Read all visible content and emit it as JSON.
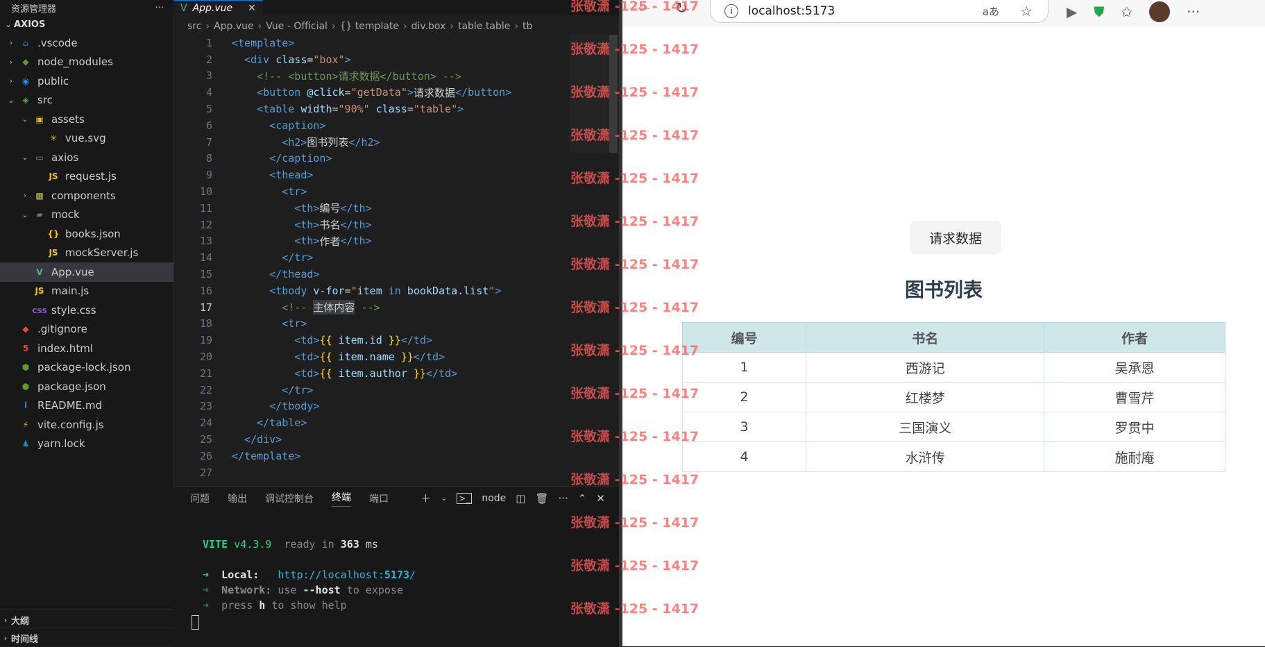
{
  "explorer": {
    "header": "资源管理器",
    "root": "AXIOS",
    "items": [
      {
        "name": ".vscode",
        "depth": 0,
        "chevron": "›",
        "icon": "vscode-folder"
      },
      {
        "name": "node_modules",
        "depth": 0,
        "chevron": "›",
        "icon": "node-folder"
      },
      {
        "name": "public",
        "depth": 0,
        "chevron": "›",
        "icon": "public-folder"
      },
      {
        "name": "src",
        "depth": 0,
        "chevron": "⌄",
        "icon": "src-folder"
      },
      {
        "name": "assets",
        "depth": 1,
        "chevron": "⌄",
        "icon": "assets-folder"
      },
      {
        "name": "vue.svg",
        "depth": 2,
        "chevron": "",
        "icon": "svg-file"
      },
      {
        "name": "axios",
        "depth": 1,
        "chevron": "⌄",
        "icon": "folder"
      },
      {
        "name": "request.js",
        "depth": 2,
        "chevron": "",
        "icon": "js-file"
      },
      {
        "name": "components",
        "depth": 1,
        "chevron": "›",
        "icon": "components-folder"
      },
      {
        "name": "mock",
        "depth": 1,
        "chevron": "⌄",
        "icon": "mock-folder"
      },
      {
        "name": "books.json",
        "depth": 2,
        "chevron": "",
        "icon": "json-file"
      },
      {
        "name": "mockServer.js",
        "depth": 2,
        "chevron": "",
        "icon": "js-file"
      },
      {
        "name": "App.vue",
        "depth": 1,
        "chevron": "",
        "icon": "vue-file",
        "selected": true
      },
      {
        "name": "main.js",
        "depth": 1,
        "chevron": "",
        "icon": "js-file"
      },
      {
        "name": "style.css",
        "depth": 1,
        "chevron": "",
        "icon": "css-file"
      },
      {
        "name": ".gitignore",
        "depth": 0,
        "chevron": "",
        "icon": "git-file"
      },
      {
        "name": "index.html",
        "depth": 0,
        "chevron": "",
        "icon": "html-file"
      },
      {
        "name": "package-lock.json",
        "depth": 0,
        "chevron": "",
        "icon": "node-file"
      },
      {
        "name": "package.json",
        "depth": 0,
        "chevron": "",
        "icon": "node-file"
      },
      {
        "name": "README.md",
        "depth": 0,
        "chevron": "",
        "icon": "info-file"
      },
      {
        "name": "vite.config.js",
        "depth": 0,
        "chevron": "",
        "icon": "vite-file"
      },
      {
        "name": "yarn.lock",
        "depth": 0,
        "chevron": "",
        "icon": "yarn-file"
      }
    ],
    "outline": "大纲",
    "timeline": "时间线"
  },
  "editor": {
    "tab": "App.vue",
    "breadcrumb": [
      "src",
      "App.vue",
      "Vue - Official",
      "{} template",
      "div.box",
      "table.table",
      "tb"
    ],
    "active_line": 17,
    "lines": [
      [
        [
          "tg",
          "<template>"
        ]
      ],
      [
        [
          "pu",
          "  "
        ],
        [
          "tg",
          "<div "
        ],
        [
          "at",
          "class"
        ],
        [
          "tx",
          "="
        ],
        [
          "st",
          "\"box\""
        ],
        [
          "tg",
          ">"
        ]
      ],
      [
        [
          "cm",
          "    <!-- <button>请求数据</button> -->"
        ]
      ],
      [
        [
          "tg",
          "    <button "
        ],
        [
          "at",
          "@click"
        ],
        [
          "tx",
          "="
        ],
        [
          "st",
          "\"getData\""
        ],
        [
          "tg",
          ">"
        ],
        [
          "tx",
          "请求数据"
        ],
        [
          "tg",
          "</button>"
        ]
      ],
      [
        [
          "tg",
          "    <table "
        ],
        [
          "at",
          "width"
        ],
        [
          "tx",
          "="
        ],
        [
          "st",
          "\"90%\""
        ],
        [
          "at",
          " class"
        ],
        [
          "tx",
          "="
        ],
        [
          "st",
          "\"table\""
        ],
        [
          "tg",
          ">"
        ]
      ],
      [
        [
          "tg",
          "      <caption>"
        ]
      ],
      [
        [
          "tg",
          "        <h2>"
        ],
        [
          "tx",
          "图书列表"
        ],
        [
          "tg",
          "</h2>"
        ]
      ],
      [
        [
          "tg",
          "      </caption>"
        ]
      ],
      [
        [
          "tg",
          "      <thead>"
        ]
      ],
      [
        [
          "tg",
          "        <tr>"
        ]
      ],
      [
        [
          "tg",
          "          <th>"
        ],
        [
          "tx",
          "编号"
        ],
        [
          "tg",
          "</th>"
        ]
      ],
      [
        [
          "tg",
          "          <th>"
        ],
        [
          "tx",
          "书名"
        ],
        [
          "tg",
          "</th>"
        ]
      ],
      [
        [
          "tg",
          "          <th>"
        ],
        [
          "tx",
          "作者"
        ],
        [
          "tg",
          "</th>"
        ]
      ],
      [
        [
          "tg",
          "        </tr>"
        ]
      ],
      [
        [
          "tg",
          "      </thead>"
        ]
      ],
      [
        [
          "tg",
          "      <tbody "
        ],
        [
          "at",
          "v-for"
        ],
        [
          "tx",
          "="
        ],
        [
          "st",
          "\""
        ],
        [
          "at",
          "item"
        ],
        [
          "tg",
          " in "
        ],
        [
          "at",
          "bookData.list"
        ],
        [
          "st",
          "\""
        ],
        [
          "tg",
          ">"
        ]
      ],
      [
        [
          "cm",
          "        <!-- "
        ],
        [
          "hl",
          "主体内容"
        ],
        [
          "cm",
          " -->"
        ]
      ],
      [
        [
          "tg",
          "        <tr>"
        ]
      ],
      [
        [
          "tg",
          "          <td>"
        ],
        [
          "br",
          "{{"
        ],
        [
          "at",
          " item.id "
        ],
        [
          "br",
          "}}"
        ],
        [
          "tg",
          "</td>"
        ]
      ],
      [
        [
          "tg",
          "          <td>"
        ],
        [
          "br",
          "{{"
        ],
        [
          "at",
          " item.name "
        ],
        [
          "br",
          "}}"
        ],
        [
          "tg",
          "</td>"
        ]
      ],
      [
        [
          "tg",
          "          <td>"
        ],
        [
          "br",
          "{{"
        ],
        [
          "at",
          " item.author "
        ],
        [
          "br",
          "}}"
        ],
        [
          "tg",
          "</td>"
        ]
      ],
      [
        [
          "tg",
          "        </tr>"
        ]
      ],
      [
        [
          "tg",
          "      </tbody>"
        ]
      ],
      [
        [
          "tg",
          "    </table>"
        ]
      ],
      [
        [
          "tg",
          "  </div>"
        ]
      ],
      [
        [
          "tg",
          "</template>"
        ]
      ],
      [
        [
          "tx",
          ""
        ]
      ]
    ]
  },
  "panel": {
    "tabs": [
      "问题",
      "输出",
      "调试控制台",
      "终端",
      "端口"
    ],
    "active_tab": "终端",
    "shell": "node",
    "terminal": {
      "vite": "VITE",
      "version": "v4.3.9",
      "ready": "ready in",
      "ms_value": "363",
      "ms_unit": "ms",
      "local_label": "Local:",
      "local_url_pre": "http://localhost:",
      "local_port": "5173",
      "network_label": "Network:",
      "network_text_1": "use",
      "network_flag": "--host",
      "network_text_2": "to expose",
      "help_1": "press",
      "help_key": "h",
      "help_2": "to show help"
    }
  },
  "browser": {
    "url": "localhost:5173",
    "button": "请求数据",
    "caption": "图书列表",
    "headers": [
      "编号",
      "书名",
      "作者"
    ],
    "rows": [
      [
        "1",
        "西游记",
        "吴承恩"
      ],
      [
        "2",
        "红楼梦",
        "曹雪芹"
      ],
      [
        "3",
        "三国演义",
        "罗贯中"
      ],
      [
        "4",
        "水浒传",
        "施耐庵"
      ]
    ]
  },
  "watermark": "张敬潇 -125 - 1417"
}
